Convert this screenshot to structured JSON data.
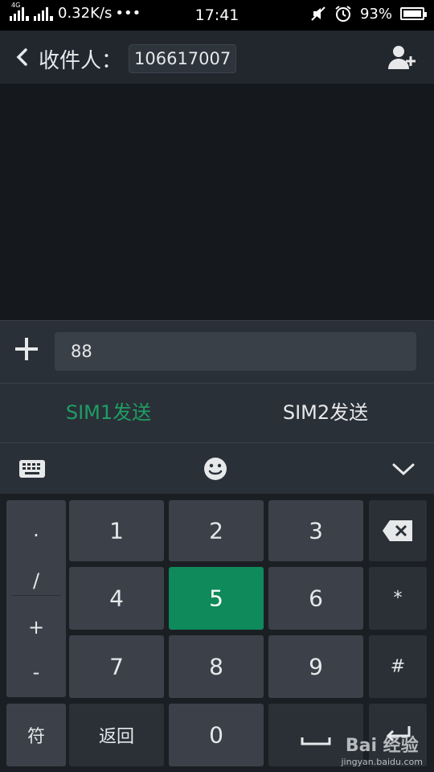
{
  "status_bar": {
    "network_type": "4G",
    "speed": "0.32K/s",
    "more": "•••",
    "time": "17:41",
    "battery": "93%"
  },
  "header": {
    "back_icon": "back-arrow-icon",
    "recipient_label": "收件人：",
    "recipient_value": "106617007",
    "add_contact_icon": "add-contact-icon"
  },
  "compose": {
    "attach_icon": "plus-icon",
    "message_text": "88"
  },
  "send_options": {
    "sim1": "SIM1发送",
    "sim2": "SIM2发送"
  },
  "toolbar": {
    "keyboard_icon": "keyboard-icon",
    "emoji_icon": "emoji-icon",
    "collapse_icon": "chevron-down-icon"
  },
  "keyboard": {
    "symbols": [
      "·",
      "/",
      "+",
      "-"
    ],
    "digits": [
      "1",
      "2",
      "3",
      "4",
      "5",
      "6",
      "7",
      "8",
      "9",
      "0"
    ],
    "backspace_icon": "backspace-icon",
    "star": "*",
    "hash": "#",
    "fu": "符",
    "back": "返回",
    "space_icon": "space-icon",
    "enter_icon": "enter-icon",
    "active_key": "5"
  },
  "watermark": {
    "brand": "Bai 经验",
    "url": "jingyan.baidu.com"
  },
  "colors": {
    "accent_green": "#0e8a5b",
    "sim1_text": "#1e9e64"
  }
}
